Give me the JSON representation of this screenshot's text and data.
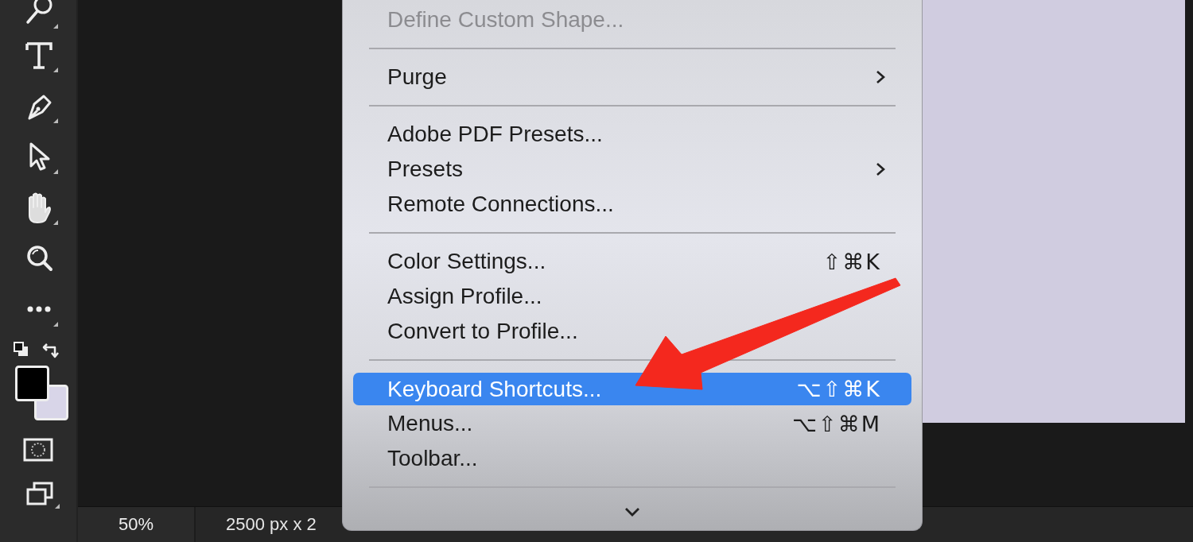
{
  "status_bar": {
    "zoom": "50%",
    "document_info": "2500 px x 2"
  },
  "menu": {
    "items": [
      {
        "kind": "item",
        "label": "Define Custom Shape...",
        "disabled": true,
        "selected": false
      },
      {
        "kind": "separator"
      },
      {
        "kind": "item",
        "label": "Purge",
        "submenu": true,
        "disabled": false,
        "selected": false
      },
      {
        "kind": "separator"
      },
      {
        "kind": "item",
        "label": "Adobe PDF Presets...",
        "disabled": false,
        "selected": false
      },
      {
        "kind": "item",
        "label": "Presets",
        "submenu": true,
        "disabled": false,
        "selected": false
      },
      {
        "kind": "item",
        "label": "Remote Connections...",
        "disabled": false,
        "selected": false
      },
      {
        "kind": "separator"
      },
      {
        "kind": "item",
        "label": "Color Settings...",
        "shortcut": "⇧⌘K",
        "disabled": false,
        "selected": false
      },
      {
        "kind": "item",
        "label": "Assign Profile...",
        "disabled": false,
        "selected": false
      },
      {
        "kind": "item",
        "label": "Convert to Profile...",
        "disabled": false,
        "selected": false
      },
      {
        "kind": "separator"
      },
      {
        "kind": "item",
        "label": "Keyboard Shortcuts...",
        "shortcut": "⌥⇧⌘K",
        "disabled": false,
        "selected": true
      },
      {
        "kind": "item",
        "label": "Menus...",
        "shortcut": "⌥⇧⌘M",
        "disabled": false,
        "selected": false
      },
      {
        "kind": "item",
        "label": "Toolbar...",
        "disabled": false,
        "selected": false
      },
      {
        "kind": "separator"
      },
      {
        "kind": "scroll_down"
      }
    ]
  }
}
